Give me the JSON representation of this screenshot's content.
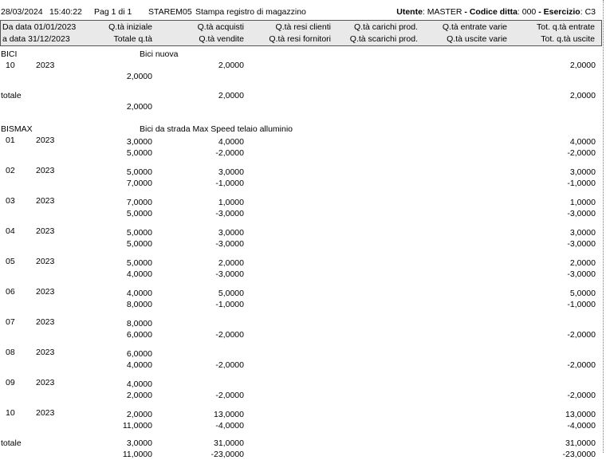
{
  "header": {
    "date": "28/03/2024",
    "time": "15:40:22",
    "page": "Pag 1 di 1",
    "report_code": "STAREM05",
    "report_title": "Stampa registro di magazzino",
    "utente_label": "Utente",
    "utente_value": ": MASTER",
    "ditta_label": " - Codice ditta",
    "ditta_value": ": 000",
    "esercizio_label": " - Esercizio",
    "esercizio_value": ": C3"
  },
  "columns": {
    "da_data": "Da data 01/01/2023",
    "a_data": "a data 31/12/2023",
    "r1": [
      "Q.tà iniziale",
      "Q.tà acquisti",
      "Q.tà resi clienti",
      "Q.tà carichi prod.",
      "Q.tà entrate varie",
      "Tot. q.tà entrate"
    ],
    "r2": [
      "Totale q.tà",
      "Q.tà vendite",
      "Q.tà resi fornitori",
      "Q.tà scarichi prod.",
      "Q.tà uscite varie",
      "Tot. q.tà uscite"
    ]
  },
  "articles": [
    {
      "code": "BICI",
      "description": "Bici nuova",
      "rows": [
        {
          "month": "10",
          "year": "2023",
          "r1": [
            "",
            "2,0000",
            "2,0000"
          ],
          "r2": [
            "2,0000",
            "",
            ""
          ]
        }
      ],
      "total": {
        "label": "totale",
        "r1": [
          "",
          "2,0000",
          "2,0000"
        ],
        "r2": [
          "2,0000",
          "",
          ""
        ]
      }
    },
    {
      "code": "BISMAX",
      "description": "Bici da strada Max Speed telaio alluminio",
      "rows": [
        {
          "month": "01",
          "year": "2023",
          "r1": [
            "3,0000",
            "4,0000",
            "4,0000"
          ],
          "r2": [
            "5,0000",
            "-2,0000",
            "-2,0000"
          ]
        },
        {
          "month": "02",
          "year": "2023",
          "r1": [
            "5,0000",
            "3,0000",
            "3,0000"
          ],
          "r2": [
            "7,0000",
            "-1,0000",
            "-1,0000"
          ]
        },
        {
          "month": "03",
          "year": "2023",
          "r1": [
            "7,0000",
            "1,0000",
            "1,0000"
          ],
          "r2": [
            "5,0000",
            "-3,0000",
            "-3,0000"
          ]
        },
        {
          "month": "04",
          "year": "2023",
          "r1": [
            "5,0000",
            "3,0000",
            "3,0000"
          ],
          "r2": [
            "5,0000",
            "-3,0000",
            "-3,0000"
          ]
        },
        {
          "month": "05",
          "year": "2023",
          "r1": [
            "5,0000",
            "2,0000",
            "2,0000"
          ],
          "r2": [
            "4,0000",
            "-3,0000",
            "-3,0000"
          ]
        },
        {
          "month": "06",
          "year": "2023",
          "r1": [
            "4,0000",
            "5,0000",
            "5,0000"
          ],
          "r2": [
            "8,0000",
            "-1,0000",
            "-1,0000"
          ]
        },
        {
          "month": "07",
          "year": "2023",
          "r1": [
            "8,0000",
            "",
            ""
          ],
          "r2": [
            "6,0000",
            "-2,0000",
            "-2,0000"
          ]
        },
        {
          "month": "08",
          "year": "2023",
          "r1": [
            "6,0000",
            "",
            ""
          ],
          "r2": [
            "4,0000",
            "-2,0000",
            "-2,0000"
          ]
        },
        {
          "month": "09",
          "year": "2023",
          "r1": [
            "4,0000",
            "",
            ""
          ],
          "r2": [
            "2,0000",
            "-2,0000",
            "-2,0000"
          ]
        },
        {
          "month": "10",
          "year": "2023",
          "r1": [
            "2,0000",
            "13,0000",
            "13,0000"
          ],
          "r2": [
            "11,0000",
            "-4,0000",
            "-4,0000"
          ]
        }
      ],
      "total": {
        "label": "totale",
        "r1": [
          "3,0000",
          "31,0000",
          "31,0000"
        ],
        "r2": [
          "11,0000",
          "-23,0000",
          "-23,0000"
        ]
      }
    }
  ]
}
